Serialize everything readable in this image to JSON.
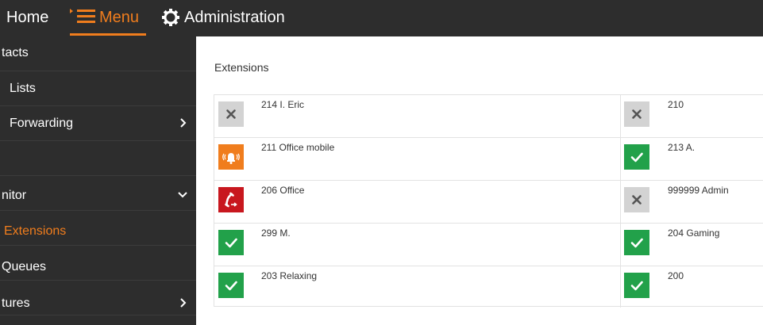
{
  "header": {
    "home_label": "Home",
    "menu_label": "Menu",
    "admin_label": "Administration",
    "accent_color": "#f07d1d"
  },
  "sidebar": {
    "items": [
      {
        "label": "tacts",
        "has_chevron": false,
        "chevron": ""
      },
      {
        "label": "Lists",
        "has_chevron": false,
        "chevron": ""
      },
      {
        "label": "Forwarding",
        "has_chevron": true,
        "chevron": "chevron-right"
      },
      {
        "label": "",
        "has_chevron": false,
        "chevron": ""
      },
      {
        "label": "nitor",
        "has_chevron": true,
        "chevron": "chevron-down"
      },
      {
        "label": "Extensions",
        "has_chevron": false,
        "chevron": "",
        "active": true
      },
      {
        "label": "Queues",
        "has_chevron": false,
        "chevron": ""
      },
      {
        "label": "tures",
        "has_chevron": true,
        "chevron": "chevron-right"
      }
    ]
  },
  "main": {
    "title": "Extensions",
    "extensions": [
      {
        "name": "214 I. Eric",
        "status": "offline",
        "icon": "x-icon",
        "color": "#d3d3d3"
      },
      {
        "name": "210",
        "status": "offline",
        "icon": "x-icon",
        "color": "#d3d3d3"
      },
      {
        "name": "211 Office mobile",
        "status": "ringing",
        "icon": "ringing-bell-icon",
        "color": "#f07d1d"
      },
      {
        "name": "213 A.",
        "status": "available",
        "icon": "check-icon",
        "color": "#22a14a"
      },
      {
        "name": "206 Office",
        "status": "in-call",
        "icon": "phone-outgoing-icon",
        "color": "#c8171e"
      },
      {
        "name": "999999 Admin",
        "status": "offline",
        "icon": "x-icon",
        "color": "#d3d3d3"
      },
      {
        "name": "299 M.",
        "status": "available",
        "icon": "check-icon",
        "color": "#22a14a"
      },
      {
        "name": "204 Gaming",
        "status": "available",
        "icon": "check-icon",
        "color": "#22a14a"
      },
      {
        "name": "203 Relaxing",
        "status": "available",
        "icon": "check-icon",
        "color": "#22a14a"
      },
      {
        "name": "200",
        "status": "available",
        "icon": "check-icon",
        "color": "#22a14a"
      }
    ]
  }
}
